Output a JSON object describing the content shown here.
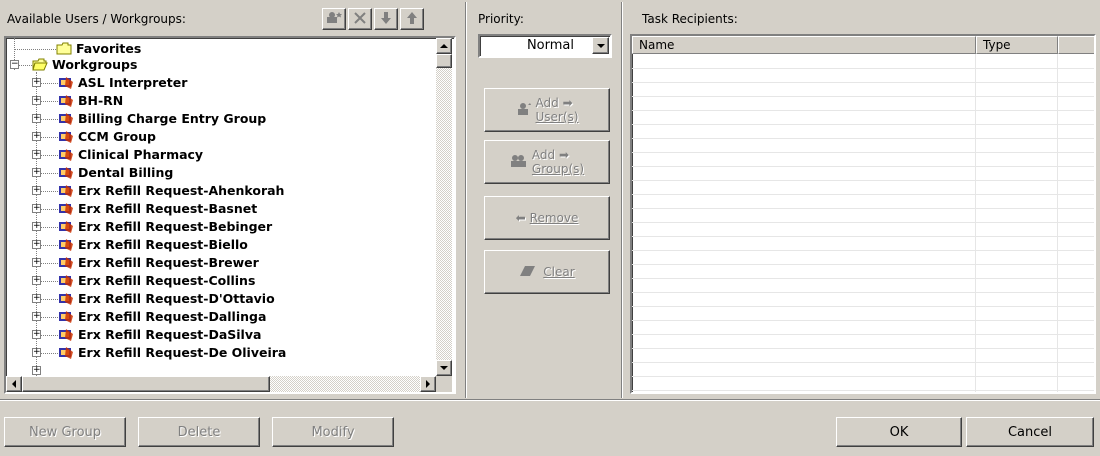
{
  "left_panel": {
    "title": "Available Users / Workgroups:",
    "tree": {
      "favorites": "Favorites",
      "workgroups": "Workgroups",
      "items": [
        "ASL Interpreter",
        "BH-RN",
        "Billing Charge Entry Group",
        "CCM Group",
        "Clinical Pharmacy",
        "Dental Billing",
        "Erx Refill Request-Ahenkorah",
        "Erx Refill Request-Basnet",
        "Erx Refill Request-Bebinger",
        "Erx Refill Request-Biello",
        "Erx Refill Request-Brewer",
        "Erx Refill Request-Collins",
        "Erx Refill Request-D'Ottavio",
        "Erx Refill Request-Dallinga",
        "Erx Refill Request-DaSilva",
        "Erx Refill Request-De Oliveira"
      ]
    }
  },
  "priority": {
    "label": "Priority:",
    "value": "Normal"
  },
  "actions": {
    "add_users_line1": "Add",
    "add_users_line2": "User(s)",
    "add_group_line1": "Add",
    "add_group_line2": "Group(s)",
    "remove": "Remove",
    "clear": "Clear"
  },
  "recipients": {
    "label": "Task Recipients:",
    "columns": [
      "Name",
      "Type"
    ]
  },
  "footer": {
    "new_group": "New Group",
    "delete": "Delete",
    "modify": "Modify",
    "ok": "OK",
    "cancel": "Cancel"
  }
}
